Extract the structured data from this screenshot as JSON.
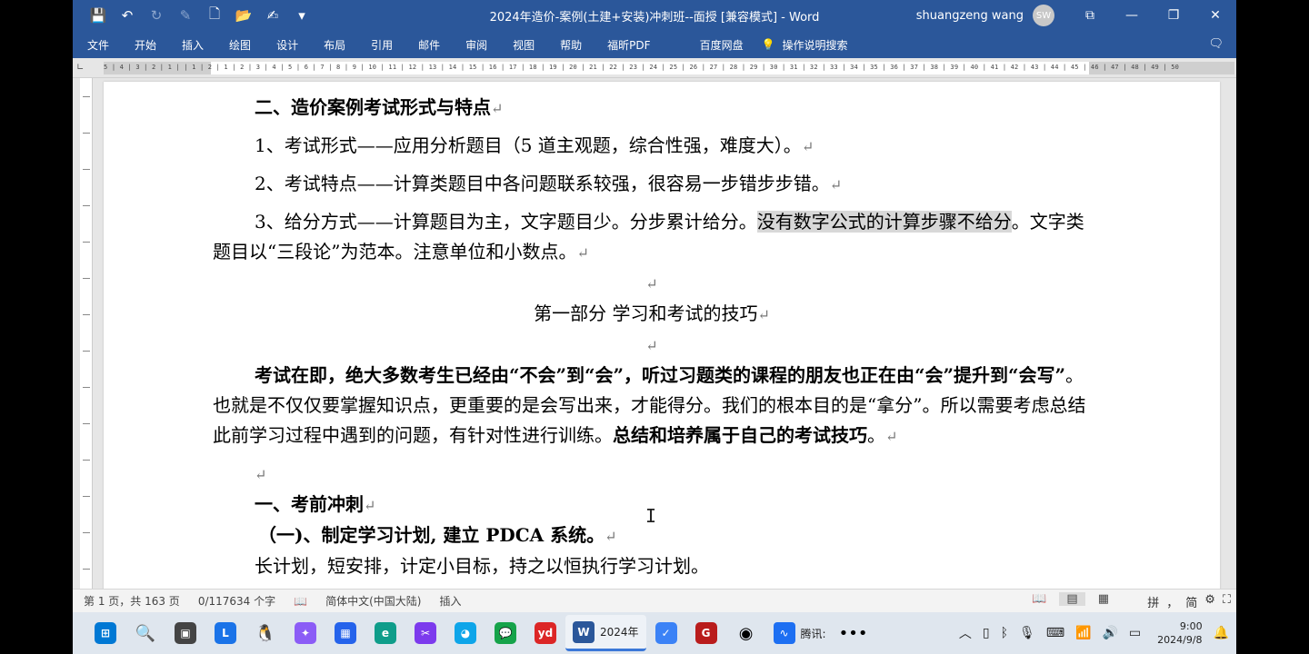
{
  "titlebar": {
    "title": "2024年造价-案例(土建+安装)冲刺班--面授 [兼容模式]  -  Word",
    "user_name": "shuangzeng wang",
    "user_initials": "SW"
  },
  "ribbon": {
    "tabs": [
      "文件",
      "开始",
      "插入",
      "绘图",
      "设计",
      "布局",
      "引用",
      "邮件",
      "审阅",
      "视图",
      "帮助",
      "福昕PDF"
    ],
    "extra_tab": "百度网盘",
    "search_label": "操作说明搜索"
  },
  "ruler": {
    "labels": "5 | 4 | 3 | 2 | 1 |  | 1 | 2 | 1 | 2 | 3 | 4 | 5 | 6 | 7 | 8 | 9 | 10 | 11 | 12 | 13 | 14 | 15 | 16 | 17 | 18 | 19 | 20 | 21 | 22 | 23 | 24 | 25 | 26 | 27 | 28 | 29 | 30 | 31 | 32 | 33 | 34 | 35 | 36 | 37 | 38 | 39 | 40 | 41 | 42 | 43 | 44 | 45 | 46 | 47 | 48 | 49 | 50"
  },
  "document": {
    "heading2": "二、造价案例考试形式与特点",
    "item1": "1、考试形式——应用分析题目（5 道主观题，综合性强，难度大）。",
    "item2": "2、考试特点——计算类题目中各问题联系较强，很容易一步错步步错。",
    "item3_pre": "3、给分方式——计算题目为主，文字题目少。分步累计给分。",
    "item3_hl1": "没有数字公式的计算步骤不给",
    "item3_hl2": "分",
    "item3_post": "。文字类题目以“三段论”为范本。注意单位和小数点。",
    "part_title": "第一部分    学习和考试的技巧",
    "intro_bold": "考试在即，绝大多数考生已经由“不会”到“会”，听过习题类的课程的朋友也正在由“会”提升到“会写”",
    "intro_mid": "。也就是不仅仅要掌握知识点，更重要的是会写出来，才能得分。我们的根本目的是“拿分”。所以需要考虑总结此前学习过程中遇到的问题，有针对性进行训练。",
    "intro_bold2": "总结和培养属于自己的考试技巧",
    "intro_end": "。",
    "section1": "一、考前冲刺",
    "sub1": "（一)、制定学习计划, 建立 PDCA 系统。",
    "partial_line": "长计划，短安排，计定小目标，持之以恒执行学习计划。",
    "para_mark": "↵"
  },
  "status": {
    "page": "第 1 页，共 163 页",
    "words": "0/117634 个字",
    "lang": "简体中文(中国大陆)",
    "mode": "插入"
  },
  "taskbar": {
    "word_label": "2024年",
    "tencent_label": "腾讯:",
    "time": "9:00",
    "date": "2024/9/8"
  }
}
